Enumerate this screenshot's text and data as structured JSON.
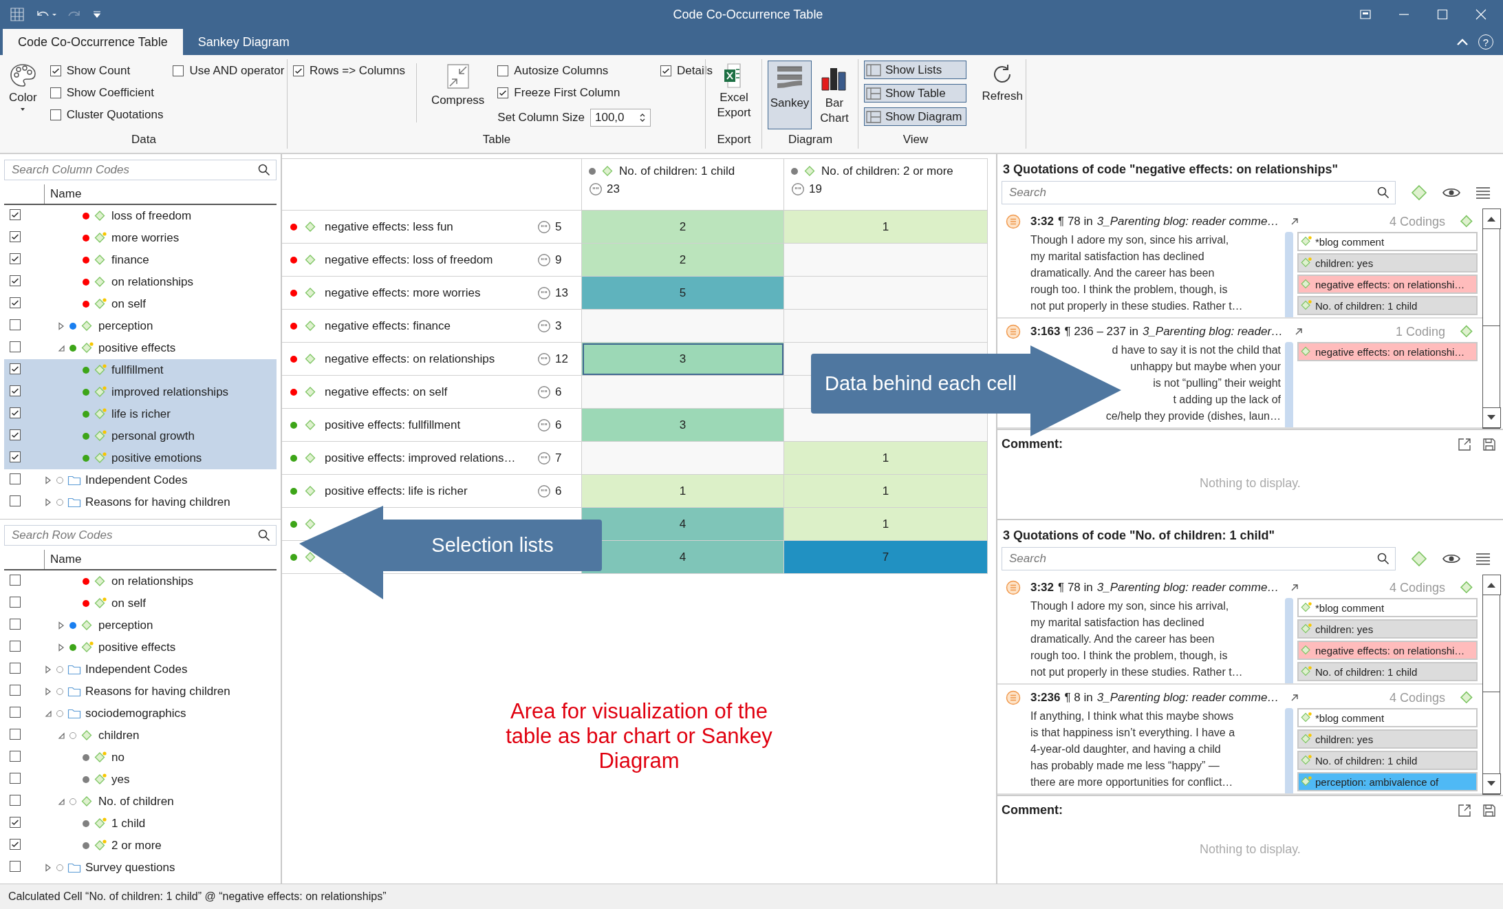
{
  "window": {
    "title": "Code Co-Occurrence Table",
    "help": "?"
  },
  "tabs": [
    {
      "label": "Code Co-Occurrence Table",
      "selected": true
    },
    {
      "label": "Sankey Diagram",
      "selected": false
    }
  ],
  "ribbon": {
    "data": {
      "label": "Data",
      "color_button": "Color",
      "options": [
        {
          "label": "Show Count",
          "checked": true
        },
        {
          "label": "Show Coefficient",
          "checked": false
        },
        {
          "label": "Cluster Quotations",
          "checked": false
        },
        {
          "label": "Use AND operator",
          "checked": false
        }
      ]
    },
    "table": {
      "label": "Table",
      "rows_to_columns": {
        "label": "Rows => Columns",
        "checked": true
      },
      "compress": "Compress",
      "options": [
        {
          "label": "Autosize Columns",
          "checked": false
        },
        {
          "label": "Freeze First Column",
          "checked": true
        }
      ],
      "column_size": {
        "label": "Set Column Size",
        "value": "100,0"
      },
      "details": {
        "label": "Details",
        "checked": true
      }
    },
    "export": {
      "label": "Export",
      "button": "Excel Export"
    },
    "diagram": {
      "label": "Diagram",
      "buttons": [
        {
          "kind": "sankey",
          "label": "Sankey",
          "selected": true
        },
        {
          "kind": "bar",
          "label": "Bar Chart",
          "selected": false
        }
      ]
    },
    "view": {
      "label": "View",
      "toggles": [
        {
          "kind": "lists",
          "label": "Show Lists",
          "selected": true
        },
        {
          "kind": "table",
          "label": "Show Table",
          "selected": true
        },
        {
          "kind": "diagram",
          "label": "Show Diagram",
          "selected": true
        }
      ],
      "refresh": "Refresh"
    }
  },
  "column_codes": {
    "search_placeholder": "Search Column Codes",
    "header": "Name",
    "items": [
      {
        "children": [
          {
            "children": [
              {
                "label": "loss of freedom",
                "kind": "code",
                "color": "#ff0000",
                "commented": false,
                "checked": true,
                "selected": false
              },
              {
                "label": "more worries",
                "kind": "code",
                "color": "#ff0000",
                "commented": true,
                "checked": true,
                "selected": false
              },
              {
                "label": "finance",
                "kind": "code",
                "color": "#ff0000",
                "commented": false,
                "checked": true,
                "selected": false
              },
              {
                "label": "on relationships",
                "kind": "code",
                "color": "#ff0000",
                "commented": false,
                "checked": true,
                "selected": false
              },
              {
                "label": "on self",
                "kind": "code",
                "color": "#ff0000",
                "commented": true,
                "checked": true,
                "selected": false
              }
            ]
          },
          {
            "label": "perception",
            "kind": "code",
            "color": "#1a7ff0",
            "commented": false,
            "checked": false,
            "selected": false,
            "expanded": false
          },
          {
            "label": "positive effects",
            "kind": "code",
            "color": "#3da518",
            "commented": true,
            "checked": false,
            "selected": false,
            "expanded": true,
            "children": [
              {
                "label": "fullfillment",
                "kind": "code",
                "color": "#3da518",
                "commented": true,
                "checked": true,
                "selected": true
              },
              {
                "label": "improved relationships",
                "kind": "code",
                "color": "#3da518",
                "commented": true,
                "checked": true,
                "selected": true
              },
              {
                "label": "life is richer",
                "kind": "code",
                "color": "#3da518",
                "commented": true,
                "checked": true,
                "selected": true
              },
              {
                "label": "personal growth",
                "kind": "code",
                "color": "#3da518",
                "commented": true,
                "checked": true,
                "selected": true
              },
              {
                "label": "positive emotions",
                "kind": "code",
                "color": "#3da518",
                "commented": true,
                "checked": true,
                "selected": true
              }
            ]
          }
        ]
      },
      {
        "label": "Independent Codes",
        "kind": "folder",
        "checked": false,
        "selected": false,
        "expanded": false
      },
      {
        "label": "Reasons for having children",
        "kind": "folder",
        "checked": false,
        "selected": false,
        "expanded": false
      }
    ]
  },
  "row_codes": {
    "search_placeholder": "Search Row Codes",
    "header": "Name",
    "items": [
      {
        "children": [
          {
            "children": [
              {
                "label": "on relationships",
                "kind": "code",
                "color": "#ff0000",
                "commented": false,
                "checked": false,
                "selected": false
              },
              {
                "label": "on self",
                "kind": "code",
                "color": "#ff0000",
                "commented": true,
                "checked": false,
                "selected": false
              }
            ]
          },
          {
            "label": "perception",
            "kind": "code",
            "color": "#1a7ff0",
            "commented": false,
            "checked": false,
            "selected": false,
            "expanded": false
          },
          {
            "label": "positive effects",
            "kind": "code",
            "color": "#3da518",
            "commented": true,
            "checked": false,
            "selected": false,
            "expanded": false
          }
        ]
      },
      {
        "label": "Independent Codes",
        "kind": "folder",
        "checked": false,
        "selected": false,
        "expanded": false
      },
      {
        "label": "Reasons for having children",
        "kind": "folder",
        "checked": false,
        "selected": false,
        "expanded": false
      },
      {
        "label": "sociodemographics",
        "kind": "folder",
        "checked": false,
        "selected": false,
        "expanded": true,
        "children": [
          {
            "label": "children",
            "kind": "code",
            "commented": false,
            "checked": false,
            "selected": false,
            "expanded": true,
            "children": [
              {
                "label": "no",
                "kind": "code",
                "color": "#808080",
                "commented": true,
                "checked": false,
                "selected": false
              },
              {
                "label": "yes",
                "kind": "code",
                "color": "#808080",
                "commented": true,
                "checked": false,
                "selected": false
              }
            ]
          },
          {
            "label": "No. of children",
            "kind": "code",
            "commented": false,
            "checked": false,
            "selected": false,
            "expanded": true,
            "children": [
              {
                "label": "1 child",
                "kind": "code",
                "color": "#808080",
                "commented": true,
                "checked": true,
                "selected": false
              },
              {
                "label": "2 or more",
                "kind": "code",
                "color": "#808080",
                "commented": true,
                "checked": true,
                "selected": false
              }
            ]
          }
        ]
      },
      {
        "label": "Survey questions",
        "kind": "folder",
        "checked": false,
        "selected": false,
        "expanded": false
      }
    ]
  },
  "table": {
    "columns": [
      {
        "label": "No. of children: 1 child",
        "count": "23",
        "color": "#808080"
      },
      {
        "label": "No. of children: 2 or more",
        "count": "19",
        "color": "#808080"
      }
    ],
    "rows": [
      {
        "label": "negative effects: less fun",
        "count": "5",
        "color": "#ff0000",
        "cells": [
          {
            "value": "2",
            "selected": false
          },
          {
            "value": "1",
            "selected": false
          }
        ]
      },
      {
        "label": "negative effects: loss of freedom",
        "count": "9",
        "color": "#ff0000",
        "cells": [
          {
            "value": "2",
            "selected": false
          },
          {
            "selected": false
          }
        ]
      },
      {
        "label": "negative effects: more worries",
        "count": "13",
        "color": "#ff0000",
        "cells": [
          {
            "value": "5",
            "selected": false
          },
          {
            "selected": false
          }
        ]
      },
      {
        "label": "negative effects: finance",
        "count": "3",
        "color": "#ff0000",
        "cells": [
          {
            "selected": false
          },
          {
            "selected": false
          }
        ]
      },
      {
        "label": "negative effects: on relationships",
        "count": "12",
        "color": "#ff0000",
        "cells": [
          {
            "value": "3",
            "selected": true
          },
          {
            "selected": false
          }
        ]
      },
      {
        "label": "negative effects: on self",
        "count": "6",
        "color": "#ff0000",
        "cells": [
          {
            "selected": false
          },
          {
            "selected": false
          }
        ]
      },
      {
        "label": "positive effects: fullfillment",
        "count": "6",
        "color": "#3da518",
        "cells": [
          {
            "value": "3",
            "selected": false
          },
          {
            "selected": false
          }
        ]
      },
      {
        "label": "positive effects: improved relations…",
        "count": "7",
        "color": "#3da518",
        "cells": [
          {
            "selected": false
          },
          {
            "value": "1",
            "selected": false
          }
        ]
      },
      {
        "label": "positive effects: life is richer",
        "count": "6",
        "color": "#3da518",
        "cells": [
          {
            "value": "1",
            "selected": false
          },
          {
            "value": "1",
            "selected": false
          }
        ]
      },
      {
        "color": "#3da518",
        "cells": [
          {
            "value": "4",
            "selected": false
          },
          {
            "value": "1",
            "selected": false
          }
        ]
      },
      {
        "color": "#3da518",
        "cells": [
          {
            "value": "4",
            "selected": false
          },
          {
            "value": "7",
            "selected": false
          }
        ]
      }
    ]
  },
  "visualization_note": "Area for visualization of the table as bar chart or Sankey Diagram",
  "quotation_panels": [
    {
      "title": "3 Quotations of code \"negative effects: on relationships\"",
      "search_placeholder": "Search",
      "comment_label": "Comment:",
      "empty_text": "Nothing to display.",
      "quotations": [
        {
          "id": "3:32",
          "location": "¶ 78 in",
          "document": "3_Parenting blog: reader comme…",
          "codings": "4 Codings",
          "partly_hidden": false,
          "lines": [
            "Though I adore my son, since his arrival,",
            "my marital satisfaction has declined",
            "dramatically. And the career has been",
            "rough too. I think the problem, though, is",
            "not put properly in these studies. Rather t…"
          ],
          "codes": [
            {
              "label": "*blog comment",
              "color": "#ffffff",
              "commented": true
            },
            {
              "label": "children: yes",
              "color": "#dcdcdc",
              "commented": true
            },
            {
              "label": "negative effects: on relationshi…",
              "color": "#ffbcbc",
              "commented": false
            },
            {
              "label": "No. of children: 1 child",
              "color": "#dcdcdc",
              "commented": true
            }
          ]
        },
        {
          "id": "3:163",
          "location": "¶ 236 – 237 in",
          "document": "3_Parenting blog: reader…",
          "codings": "1 Coding",
          "partly_hidden": true,
          "lines": [
            "d have to say it is not the child that",
            "unhappy but maybe when your",
            "is not “pulling” their weight",
            "t adding up the lack of",
            "ce/help they provide (dishes, laun…"
          ],
          "codes": [
            {
              "label": "negative effects: on relationshi…",
              "color": "#ffbcbc",
              "commented": false
            }
          ]
        }
      ]
    },
    {
      "title": "3 Quotations of code \"No. of children: 1 child\"",
      "search_placeholder": "Search",
      "comment_label": "Comment:",
      "empty_text": "Nothing to display.",
      "quotations": [
        {
          "id": "3:32",
          "location": "¶ 78 in",
          "document": "3_Parenting blog: reader comme…",
          "codings": "4 Codings",
          "partly_hidden": false,
          "lines": [
            "Though I adore my son, since his arrival,",
            "my marital satisfaction has declined",
            "dramatically. And the career has been",
            "rough too. I think the problem, though, is",
            "not put properly in these studies. Rather t…"
          ],
          "codes": [
            {
              "label": "*blog comment",
              "color": "#ffffff",
              "commented": true
            },
            {
              "label": "children: yes",
              "color": "#dcdcdc",
              "commented": true
            },
            {
              "label": "negative effects: on relationshi…",
              "color": "#ffbcbc",
              "commented": false
            },
            {
              "label": "No. of children: 1 child",
              "color": "#dcdcdc",
              "commented": true
            }
          ]
        },
        {
          "id": "3:236",
          "location": "¶ 8 in",
          "document": "3_Parenting blog: reader comme…",
          "codings": "4 Codings",
          "partly_hidden": false,
          "lines": [
            "If anything, I think what this maybe shows",
            "is that happiness isn’t everything. I have a",
            "4-year-old daughter, and having a child",
            "has probably made me less “happy” —",
            "there are more opportunities for conflict…"
          ],
          "codes": [
            {
              "label": "*blog comment",
              "color": "#ffffff",
              "commented": true
            },
            {
              "label": "children: yes",
              "color": "#dcdcdc",
              "commented": true
            },
            {
              "label": "No. of children: 1 child",
              "color": "#dcdcdc",
              "commented": true
            },
            {
              "label": "perception: ambivalence of",
              "color": "#4fb9f5",
              "commented": true
            }
          ]
        }
      ]
    }
  ],
  "callouts": [
    {
      "kind": "arrow_right",
      "text": "Data behind each cell"
    },
    {
      "kind": "arrow_left",
      "text": "Selection lists"
    }
  ],
  "status_bar": "Calculated Cell “No. of children: 1 child” @ “negative effects: on relationships”"
}
